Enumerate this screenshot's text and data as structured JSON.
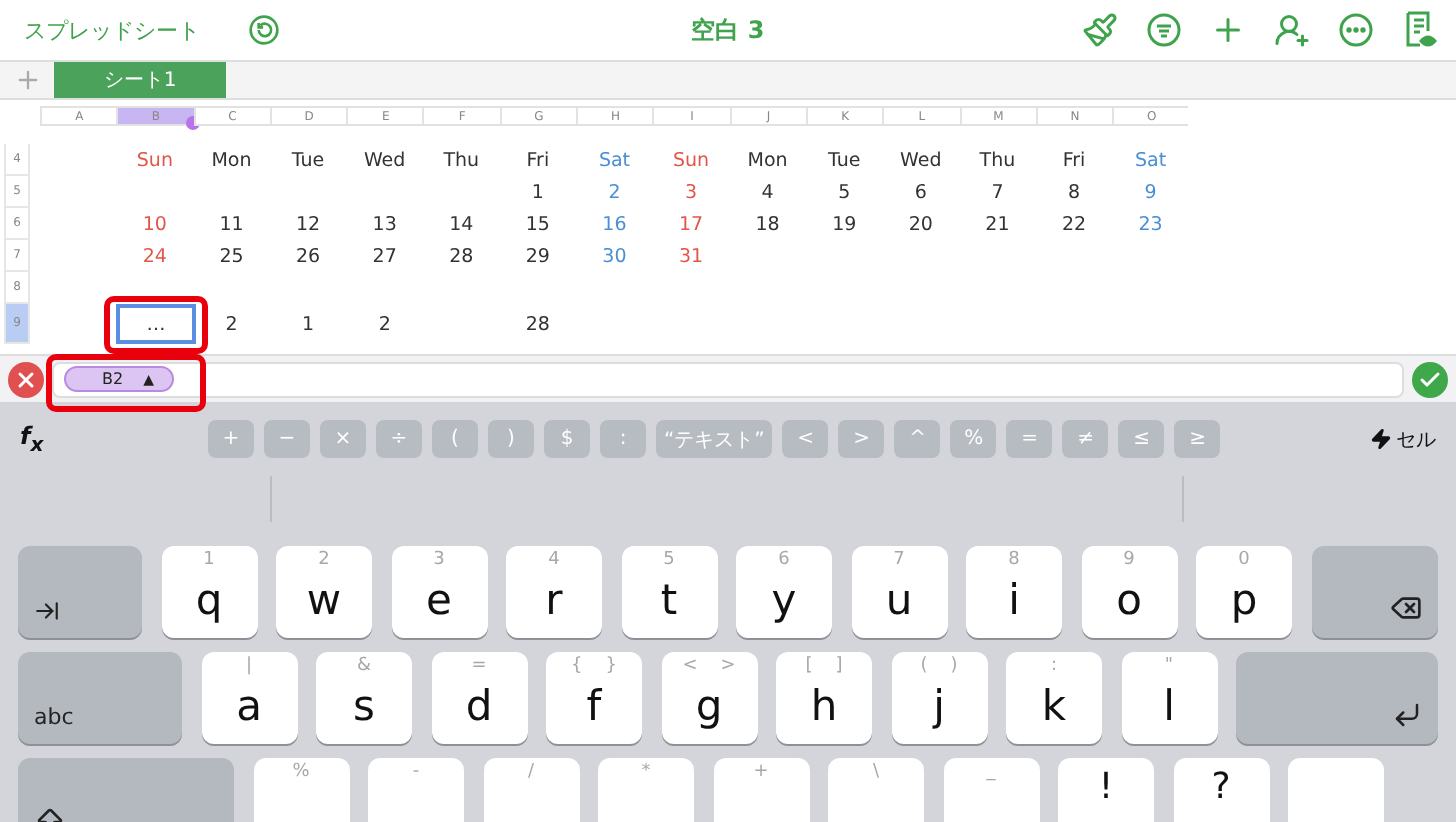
{
  "toolbar": {
    "back_label": "スプレッドシート",
    "title": "空白 3"
  },
  "sheet_tabs": [
    {
      "label": "シート1",
      "selected": true
    }
  ],
  "columns": [
    {
      "label": "A",
      "selected": false
    },
    {
      "label": "B",
      "selected": true
    },
    {
      "label": "C",
      "selected": false
    },
    {
      "label": "D",
      "selected": false
    },
    {
      "label": "E",
      "selected": false
    },
    {
      "label": "F",
      "selected": false
    },
    {
      "label": "G",
      "selected": false
    },
    {
      "label": "H",
      "selected": false
    },
    {
      "label": "I",
      "selected": false
    },
    {
      "label": "J",
      "selected": false
    },
    {
      "label": "K",
      "selected": false
    },
    {
      "label": "L",
      "selected": false
    },
    {
      "label": "M",
      "selected": false
    },
    {
      "label": "N",
      "selected": false
    },
    {
      "label": "O",
      "selected": false
    }
  ],
  "rows": [
    {
      "number": "4",
      "selected": false,
      "cells": [
        null,
        {
          "text": "Sun",
          "color": "#e0574a",
          "selected": false,
          "highlighted": false
        },
        {
          "text": "Mon",
          "color": "#333333",
          "selected": false,
          "highlighted": false
        },
        {
          "text": "Tue",
          "color": "#333333",
          "selected": false,
          "highlighted": false
        },
        {
          "text": "Wed",
          "color": "#333333",
          "selected": false,
          "highlighted": false
        },
        {
          "text": "Thu",
          "color": "#333333",
          "selected": false,
          "highlighted": false
        },
        {
          "text": "Fri",
          "color": "#333333",
          "selected": false,
          "highlighted": false
        },
        {
          "text": "Sat",
          "color": "#4a8fd6",
          "selected": false,
          "highlighted": false
        },
        {
          "text": "Sun",
          "color": "#e0574a",
          "selected": false,
          "highlighted": false
        },
        {
          "text": "Mon",
          "color": "#333333",
          "selected": false,
          "highlighted": false
        },
        {
          "text": "Tue",
          "color": "#333333",
          "selected": false,
          "highlighted": false
        },
        {
          "text": "Wed",
          "color": "#333333",
          "selected": false,
          "highlighted": false
        },
        {
          "text": "Thu",
          "color": "#333333",
          "selected": false,
          "highlighted": false
        },
        {
          "text": "Fri",
          "color": "#333333",
          "selected": false,
          "highlighted": false
        },
        {
          "text": "Sat",
          "color": "#4a8fd6",
          "selected": false,
          "highlighted": false
        }
      ]
    },
    {
      "number": "5",
      "selected": false,
      "cells": [
        null,
        null,
        null,
        null,
        null,
        null,
        {
          "text": "1",
          "color": "#333333",
          "selected": false,
          "highlighted": false
        },
        {
          "text": "2",
          "color": "#4a8fd6",
          "selected": false,
          "highlighted": false
        },
        {
          "text": "3",
          "color": "#e0574a",
          "selected": false,
          "highlighted": false
        },
        {
          "text": "4",
          "color": "#333333",
          "selected": false,
          "highlighted": false
        },
        {
          "text": "5",
          "color": "#333333",
          "selected": false,
          "highlighted": false
        },
        {
          "text": "6",
          "color": "#333333",
          "selected": false,
          "highlighted": false
        },
        {
          "text": "7",
          "color": "#333333",
          "selected": false,
          "highlighted": false
        },
        {
          "text": "8",
          "color": "#333333",
          "selected": false,
          "highlighted": false
        },
        {
          "text": "9",
          "color": "#4a8fd6",
          "selected": false,
          "highlighted": false
        }
      ]
    },
    {
      "number": "6",
      "selected": false,
      "cells": [
        null,
        {
          "text": "10",
          "color": "#e0574a",
          "selected": false,
          "highlighted": false
        },
        {
          "text": "11",
          "color": "#333333",
          "selected": false,
          "highlighted": false
        },
        {
          "text": "12",
          "color": "#333333",
          "selected": false,
          "highlighted": false
        },
        {
          "text": "13",
          "color": "#333333",
          "selected": false,
          "highlighted": false
        },
        {
          "text": "14",
          "color": "#333333",
          "selected": false,
          "highlighted": false
        },
        {
          "text": "15",
          "color": "#333333",
          "selected": false,
          "highlighted": false
        },
        {
          "text": "16",
          "color": "#4a8fd6",
          "selected": false,
          "highlighted": false
        },
        {
          "text": "17",
          "color": "#e0574a",
          "selected": false,
          "highlighted": false
        },
        {
          "text": "18",
          "color": "#333333",
          "selected": false,
          "highlighted": false
        },
        {
          "text": "19",
          "color": "#333333",
          "selected": false,
          "highlighted": false
        },
        {
          "text": "20",
          "color": "#333333",
          "selected": false,
          "highlighted": false
        },
        {
          "text": "21",
          "color": "#333333",
          "selected": false,
          "highlighted": false
        },
        {
          "text": "22",
          "color": "#333333",
          "selected": false,
          "highlighted": false
        },
        {
          "text": "23",
          "color": "#4a8fd6",
          "selected": false,
          "highlighted": false
        }
      ]
    },
    {
      "number": "7",
      "selected": false,
      "cells": [
        null,
        {
          "text": "24",
          "color": "#e0574a",
          "selected": false,
          "highlighted": false
        },
        {
          "text": "25",
          "color": "#333333",
          "selected": false,
          "highlighted": false
        },
        {
          "text": "26",
          "color": "#333333",
          "selected": false,
          "highlighted": false
        },
        {
          "text": "27",
          "color": "#333333",
          "selected": false,
          "highlighted": false
        },
        {
          "text": "28",
          "color": "#333333",
          "selected": false,
          "highlighted": false
        },
        {
          "text": "29",
          "color": "#333333",
          "selected": false,
          "highlighted": false
        },
        {
          "text": "30",
          "color": "#4a8fd6",
          "selected": false,
          "highlighted": false
        },
        {
          "text": "31",
          "color": "#e0574a",
          "selected": false,
          "highlighted": false
        }
      ]
    },
    {
      "number": "8",
      "selected": false
    },
    {
      "number": "9",
      "selected": true,
      "cells": [
        null,
        {
          "text": "…",
          "color": "#333333",
          "selected": true,
          "highlighted": true
        },
        {
          "text": "2",
          "color": "#333333",
          "selected": false,
          "highlighted": false
        },
        {
          "text": "1",
          "color": "#333333",
          "selected": false,
          "highlighted": false
        },
        {
          "text": "2",
          "color": "#333333",
          "selected": false,
          "highlighted": false
        },
        null,
        {
          "text": "28",
          "color": "#333333",
          "selected": false,
          "highlighted": false
        }
      ]
    }
  ],
  "formula_bar": {
    "token": "B2",
    "token_caret": "▲",
    "token_highlighted": true
  },
  "function_bar": {
    "label": "f$_{x}$",
    "keys": [
      "+",
      "−",
      "×",
      "÷",
      "(",
      ")",
      "$",
      ":",
      "“テキスト”",
      "<",
      ">",
      "^",
      "%",
      "=",
      "≠",
      "≤",
      "≥"
    ],
    "mode": "セル"
  },
  "keyboard": [
    [
      {
        "kind": "tab"
      },
      {
        "kind": "letter",
        "hint": "1",
        "label": "q"
      },
      {
        "kind": "letter",
        "hint": "2",
        "label": "w"
      },
      {
        "kind": "letter",
        "hint": "3",
        "label": "e"
      },
      {
        "kind": "letter",
        "hint": "4",
        "label": "r"
      },
      {
        "kind": "letter",
        "hint": "5",
        "label": "t"
      },
      {
        "kind": "letter",
        "hint": "6",
        "label": "y"
      },
      {
        "kind": "letter",
        "hint": "7",
        "label": "u"
      },
      {
        "kind": "letter",
        "hint": "8",
        "label": "i"
      },
      {
        "kind": "letter",
        "hint": "9",
        "label": "o"
      },
      {
        "kind": "letter",
        "hint": "0",
        "label": "p"
      },
      {
        "kind": "backspace"
      }
    ],
    [
      {
        "kind": "mode",
        "label": "abc"
      },
      {
        "kind": "letter",
        "hint": "|",
        "label": "a"
      },
      {
        "kind": "letter",
        "hint": "&",
        "label": "s"
      },
      {
        "kind": "letter",
        "hint": "=",
        "label": "d"
      },
      {
        "kind": "letter",
        "hint": "{    }",
        "label": "f"
      },
      {
        "kind": "letter",
        "hint": "<    >",
        "label": "g"
      },
      {
        "kind": "letter",
        "hint": "[    ]",
        "label": "h"
      },
      {
        "kind": "letter",
        "hint": "(    )",
        "label": "j"
      },
      {
        "kind": "letter",
        "hint": ":",
        "label": "k"
      },
      {
        "kind": "letter",
        "hint": "\"",
        "label": "l"
      },
      {
        "kind": "return"
      }
    ],
    [
      {
        "kind": "shift"
      },
      {
        "kind": "letter",
        "hint": "%"
      },
      {
        "kind": "letter",
        "hint": "-"
      },
      {
        "kind": "letter",
        "hint": "/"
      },
      {
        "kind": "letter",
        "hint": "*"
      },
      {
        "kind": "letter",
        "hint": "+"
      },
      {
        "kind": "letter",
        "hint": "\\"
      },
      {
        "kind": "letter",
        "hint": "_"
      },
      {
        "kind": "symbol",
        "label": "!"
      },
      {
        "kind": "symbol",
        "label": "?"
      },
      {
        "kind": "blank"
      }
    ]
  ]
}
